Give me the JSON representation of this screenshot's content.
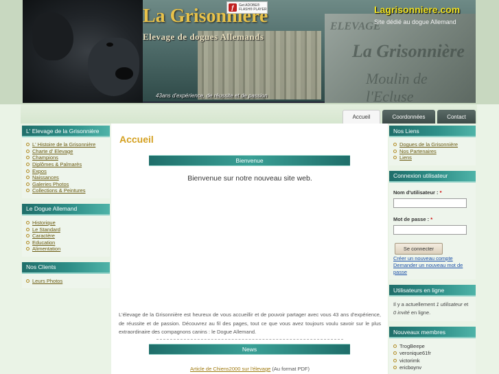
{
  "banner": {
    "title": "La Grisonniere",
    "subtitle": "Elevage de dogues Allemands",
    "tagline": "43ans d'expérience, de réussite et de passion",
    "domain": "Lagrisonniere.com",
    "description": "Site dédié au dogue Allemand",
    "flash_badge": {
      "line1": "Get ADOBE®",
      "line2": "FLASH® PLAYER"
    },
    "sign_text": {
      "s1": "ELEVAGE",
      "s2": "La Grisonnière",
      "s3": "Moulin de l'Ecluse"
    }
  },
  "tabs": [
    {
      "label": "Accueil",
      "active": true
    },
    {
      "label": "Coordonnées",
      "active": false
    },
    {
      "label": "Contact",
      "active": false
    }
  ],
  "left": {
    "elevage": {
      "title": "L' Elevage de la Grisonnière",
      "items": [
        "L' Histoire de la Grisonnière",
        "Charte d' Elevage",
        "Champions",
        "Diplômes & Palmarès",
        "Expos",
        "Naissances",
        "Galeries Photos",
        "Collections & Peintures"
      ]
    },
    "dogue": {
      "title": "Le Dogue Allemand",
      "items": [
        "Historique",
        "Le Standard",
        "Caractère",
        "Education",
        "Alimentation"
      ]
    },
    "clients": {
      "title": "Nos Clients",
      "items": [
        "Leurs Photos"
      ]
    }
  },
  "main": {
    "page_title": "Accueil",
    "bienvenue_bar": "Bienvenue",
    "welcome_text": "Bienvenue sur notre nouveau site web.",
    "paragraph": "L'élevage de la Grisonnière est heureux de vous accueillir et de pouvoir partager avec vous 43 ans d'expérience, de réussite et de passion. Découvrez au fil des pages, tout ce que vous avez toujours voulu savoir sur le plus extraordinaire des compagnons canins : le Dogue Allemand.",
    "news_bar": "News",
    "news_link": "Article de Chiens2000 sur l'élevage",
    "news_suffix": " (Au format PDF)"
  },
  "right": {
    "liens": {
      "title": "Nos Liens",
      "items": [
        "Dogues de la Grisonnière",
        "Nos Partenaires",
        "Liens"
      ]
    },
    "login": {
      "title": "Connexion utilisateur",
      "username_label": "Nom d'utilisateur :",
      "password_label": "Mot de passe :",
      "required_mark": "*",
      "submit": "Se connecter",
      "create_link": "Créer un nouveau compte",
      "reset_link": "Demander un nouveau mot de passe"
    },
    "online": {
      "title": "Utilisateurs en ligne",
      "text_a": "Il y a actuellement ",
      "users": "1 utilisateur",
      "text_b": " et ",
      "guests": "0 invité",
      "text_c": " en ligne."
    },
    "members": {
      "title": "Nouveaux membres",
      "items": [
        "TrogBeepe",
        "veronique61fr",
        "victorimk",
        "ericboynv"
      ]
    }
  },
  "colors": {
    "accent_gold": "#d4a020",
    "block_teal": "#2e8f88",
    "link_brown": "#6a5a10",
    "link_blue": "#1a4fa8"
  }
}
